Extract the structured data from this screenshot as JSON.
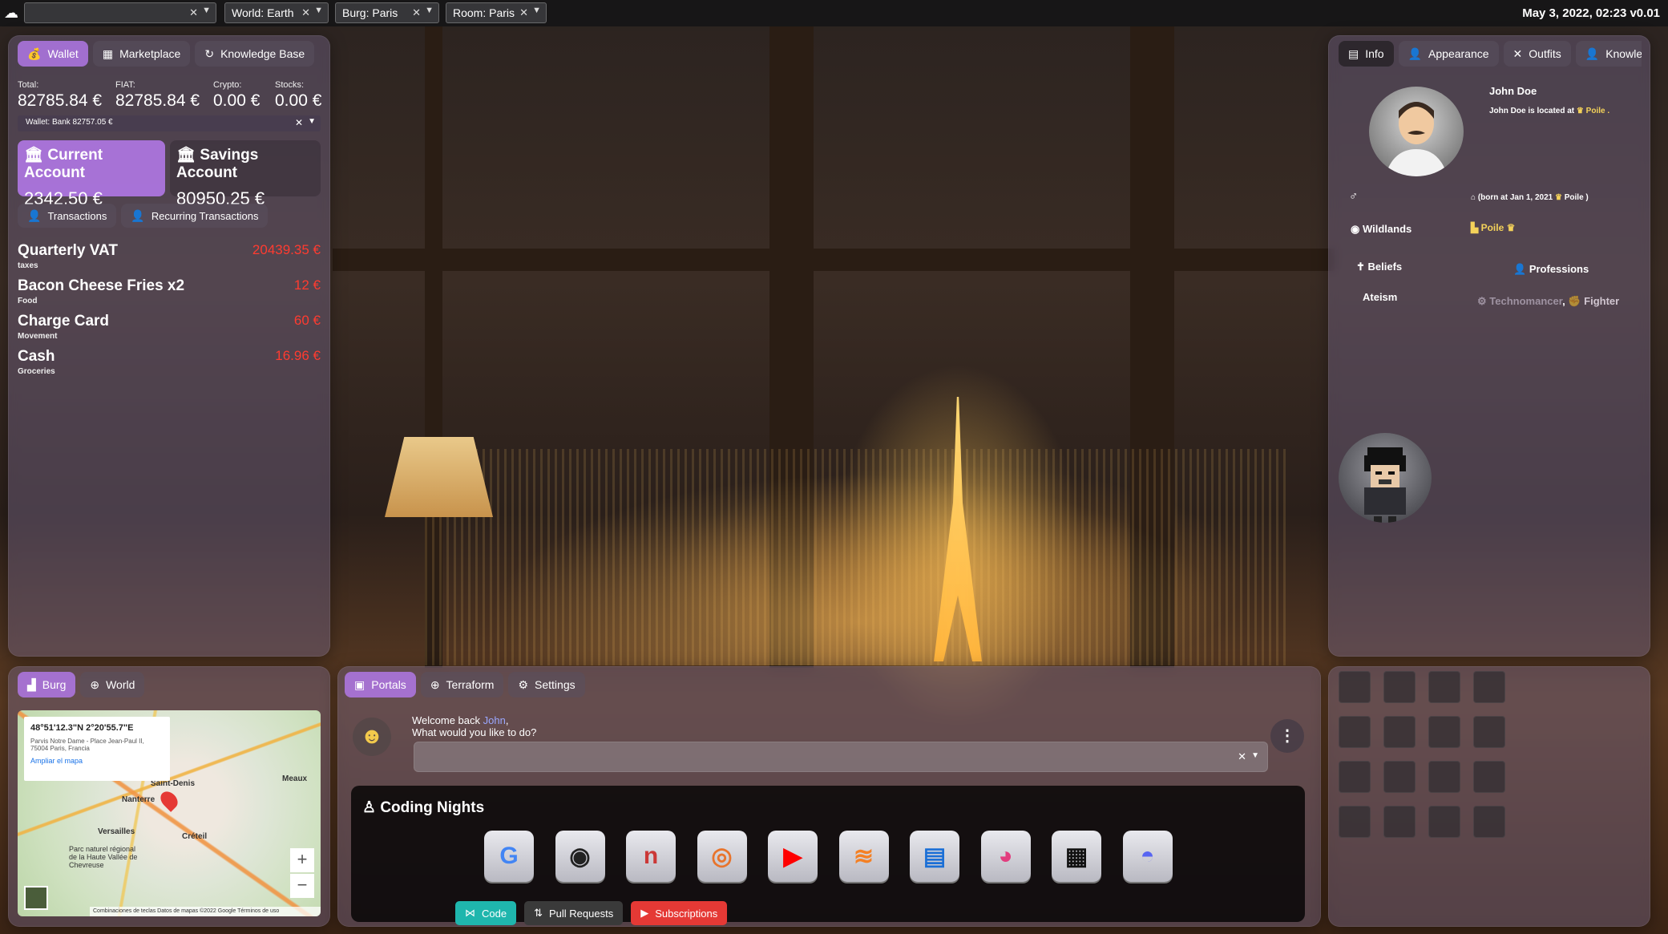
{
  "topbar": {
    "world": "World: Earth",
    "burg": "Burg: Paris",
    "room": "Room: Paris",
    "datetime": "May 3, 2022, 02:23 v0.01"
  },
  "wallet_panel": {
    "tabs": [
      "Wallet",
      "Marketplace",
      "Knowledge Base"
    ],
    "stats": [
      {
        "label": "Total:",
        "value": "82785.84 €"
      },
      {
        "label": "FIAT:",
        "value": "82785.84 €"
      },
      {
        "label": "Crypto:",
        "value": "0.00 €"
      },
      {
        "label": "Stocks:",
        "value": "0.00 €"
      }
    ],
    "wallet_select": "Wallet: Bank  82757.05 €",
    "accounts": [
      {
        "name": "Current Account",
        "balance": "2342.50 €"
      },
      {
        "name": "Savings Account",
        "balance": "80950.25 €"
      }
    ],
    "subtabs": [
      "Transactions",
      "Recurring Transactions"
    ],
    "transactions": [
      {
        "title": "Quarterly VAT",
        "category": "taxes",
        "amount": "20439.35 €"
      },
      {
        "title": "Bacon Cheese Fries x2",
        "category": "Food",
        "amount": "12 €"
      },
      {
        "title": "Charge Card",
        "category": "Movement",
        "amount": "60 €"
      },
      {
        "title": "Cash",
        "category": "Groceries",
        "amount": "16.96 €"
      }
    ]
  },
  "info_panel": {
    "tabs": [
      "Info",
      "Appearance",
      "Outfits",
      "Knowledg"
    ],
    "name": "John Doe",
    "location_prefix": "John Doe is located at",
    "location": "Poile .",
    "born": "(born at Jan 1, 2021",
    "born_place": "Poile )",
    "region": "Wildlands",
    "region_place": "Poile",
    "beliefs_label": "Beliefs",
    "belief": "Ateism",
    "professions_label": "Professions",
    "profession_faded": "Technomancer",
    "profession_sep": ",",
    "profession": "Fighter"
  },
  "map_panel": {
    "tabs": [
      "Burg",
      "World"
    ],
    "coords": "48°51'12.3\"N 2°20'55.7\"E",
    "address": "Parvis Notre Dame - Place Jean-Paul II, 75004 Paris, Francia",
    "link": "Ampliar el mapa",
    "labels": [
      "Saint-Denis",
      "Nanterre",
      "Versailles",
      "Créteil",
      "Meaux",
      "Parc naturel régional de la Haute Vallée de Chevreuse"
    ],
    "footer": "Combinaciones de teclas   Datos de mapas ©2022 Google   Términos de uso",
    "zoom_in": "+",
    "zoom_out": "−"
  },
  "portal_panel": {
    "tabs": [
      "Portals",
      "Terraform",
      "Settings"
    ],
    "welcome_prefix": "Welcome back",
    "welcome_name": "John",
    "welcome_q": "What would you like to do?",
    "input_value": "",
    "group_title": "Coding Nights",
    "apps": [
      {
        "name": "google",
        "glyph": "G",
        "color": "#4285f4"
      },
      {
        "name": "github",
        "glyph": "◉",
        "color": "#222"
      },
      {
        "name": "npm",
        "glyph": "n",
        "color": "#cb3837"
      },
      {
        "name": "podcast",
        "glyph": "◎",
        "color": "#e8742c"
      },
      {
        "name": "youtube",
        "glyph": "▶",
        "color": "#ff0000"
      },
      {
        "name": "stackoverflow",
        "glyph": "≋",
        "color": "#f48024"
      },
      {
        "name": "news",
        "glyph": "▤",
        "color": "#1b6fd6"
      },
      {
        "name": "palette",
        "glyph": "◕",
        "color": "#e23d7e"
      },
      {
        "name": "devto",
        "glyph": "▦",
        "color": "#111"
      },
      {
        "name": "discord",
        "glyph": "◓",
        "color": "#5865f2"
      }
    ],
    "chips": [
      {
        "label": "Code",
        "color": "#1fb6ad"
      },
      {
        "label": "Pull Requests",
        "color": "#3a3a3a"
      },
      {
        "label": "Subscriptions",
        "color": "#e53935"
      }
    ]
  },
  "colors": {
    "accent": "#b078e6",
    "negative": "#ff3b30",
    "gold": "#f4d25a"
  }
}
